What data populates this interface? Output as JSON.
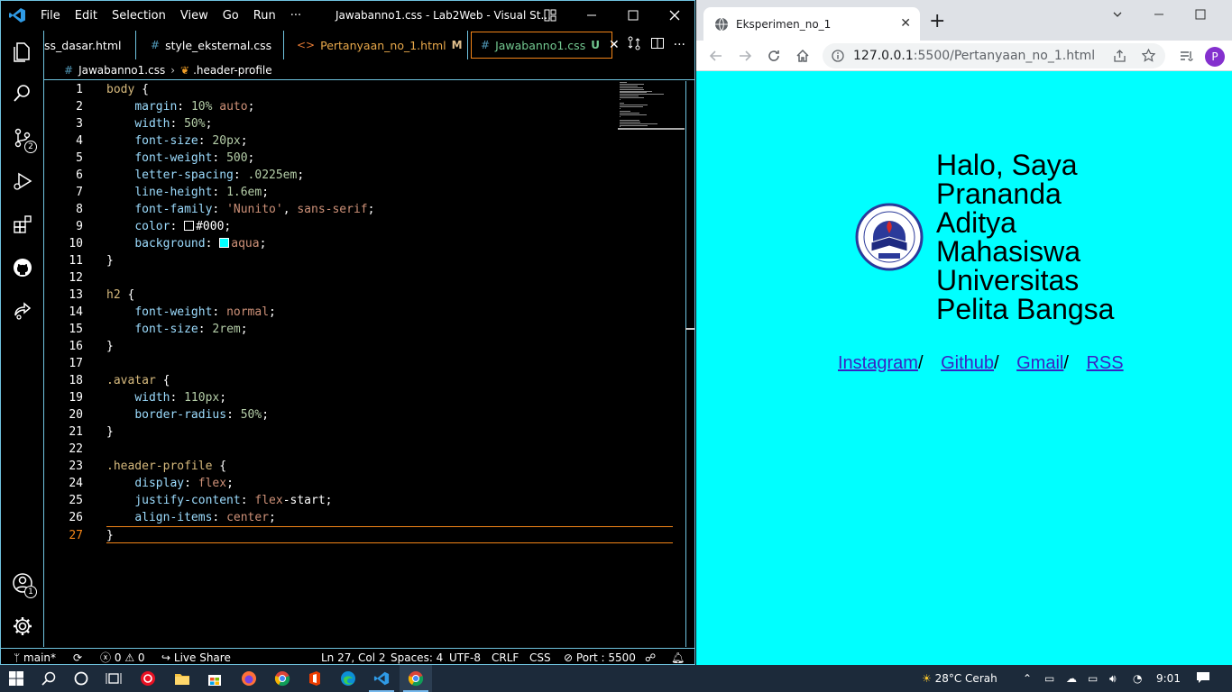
{
  "vscode": {
    "menu": [
      "File",
      "Edit",
      "Selection",
      "View",
      "Go",
      "Run",
      "···"
    ],
    "window_title": "Jawabanno1.css - Lab2Web - Visual St...",
    "tabs": [
      {
        "label": "ss_dasar.html",
        "icon": "html-icon"
      },
      {
        "label": "style_eksternal.css",
        "icon": "css-icon"
      },
      {
        "label": "Pertanyaan_no_1.html",
        "badge": "M",
        "icon": "html-icon"
      },
      {
        "label": "Jawabanno1.css",
        "badge": "U",
        "icon": "css-icon",
        "active": true
      }
    ],
    "breadcrumb": {
      "file": "Jawabanno1.css",
      "symbol": ".header-profile"
    },
    "activity_badges": {
      "scm": "2",
      "accounts": "1"
    },
    "code_lines": [
      {
        "n": "1",
        "t": "body {"
      },
      {
        "n": "2",
        "t": "    margin: 10% auto;"
      },
      {
        "n": "3",
        "t": "    width: 50%;"
      },
      {
        "n": "4",
        "t": "    font-size: 20px;"
      },
      {
        "n": "5",
        "t": "    font-weight: 500;"
      },
      {
        "n": "6",
        "t": "    letter-spacing: .0225em;"
      },
      {
        "n": "7",
        "t": "    line-height: 1.6em;"
      },
      {
        "n": "8",
        "t": "    font-family: 'Nunito', sans-serif;"
      },
      {
        "n": "9",
        "t": "    color: #000;"
      },
      {
        "n": "10",
        "t": "    background: aqua;"
      },
      {
        "n": "11",
        "t": "}"
      },
      {
        "n": "12",
        "t": ""
      },
      {
        "n": "13",
        "t": "h2 {"
      },
      {
        "n": "14",
        "t": "    font-weight: normal;"
      },
      {
        "n": "15",
        "t": "    font-size: 2rem;"
      },
      {
        "n": "16",
        "t": "}"
      },
      {
        "n": "17",
        "t": ""
      },
      {
        "n": "18",
        "t": ".avatar {"
      },
      {
        "n": "19",
        "t": "    width: 110px;"
      },
      {
        "n": "20",
        "t": "    border-radius: 50%;"
      },
      {
        "n": "21",
        "t": "}"
      },
      {
        "n": "22",
        "t": ""
      },
      {
        "n": "23",
        "t": ".header-profile {"
      },
      {
        "n": "24",
        "t": "    display: flex;"
      },
      {
        "n": "25",
        "t": "    justify-content: flex-start;"
      },
      {
        "n": "26",
        "t": "    align-items: center;"
      },
      {
        "n": "27",
        "t": "}"
      }
    ],
    "current_line": "27",
    "status": {
      "branch": "main*",
      "errors": "0",
      "warnings": "0",
      "live_share": "Live Share",
      "cursor": "Ln 27, Col 2",
      "spaces": "Spaces: 4",
      "encoding": "UTF-8",
      "eol": "CRLF",
      "language": "CSS",
      "port": "Port : 5500"
    }
  },
  "chrome": {
    "tab_title": "Eksperimen_no_1",
    "new_tab": "+",
    "url_host": "127.0.0.1",
    "url_path": ":5500/Pertanyaan_no_1.html",
    "profile_initial": "P",
    "page": {
      "heading": "Halo, Saya Prananda Aditya Mahasiswa Universitas Pelita Bangsa",
      "links": [
        {
          "label": "Instagram",
          "sep": "/"
        },
        {
          "label": "Github",
          "sep": "/"
        },
        {
          "label": "Gmail",
          "sep": "/"
        },
        {
          "label": "RSS",
          "sep": ""
        }
      ],
      "background": "#00ffff"
    }
  },
  "taskbar": {
    "weather": "28°C  Cerah",
    "time": "9:01"
  }
}
